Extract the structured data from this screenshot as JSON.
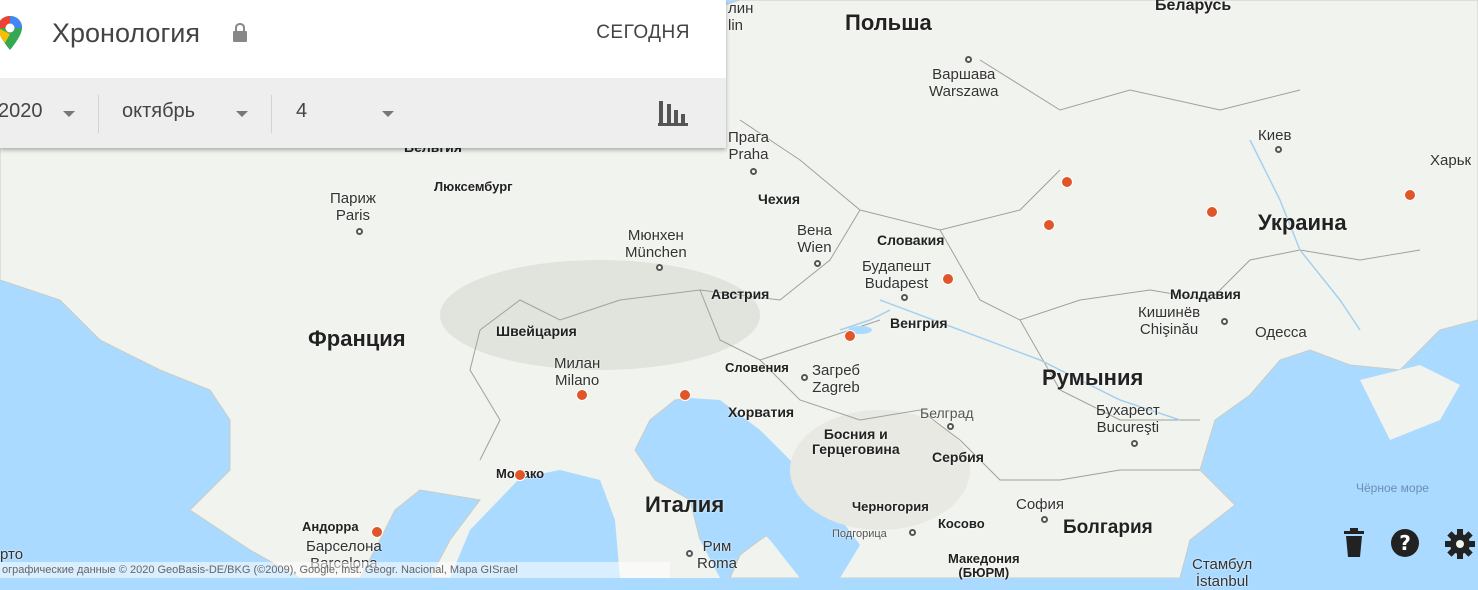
{
  "header": {
    "title": "Хронология",
    "today_label": "СЕГОДНЯ"
  },
  "selectors": {
    "year": "2020",
    "month": "октябрь",
    "day": "4"
  },
  "attribution": "ографические данные © 2020 GeoBasis-DE/BKG (©2009), Google, Inst. Geogr. Nacional, Mapa GISrael",
  "icons": [
    "maps-pin-icon",
    "lock-icon",
    "dropdown-caret-icon",
    "bar-chart-icon",
    "trash-icon",
    "help-icon",
    "settings-icon"
  ],
  "colors": {
    "marker": "#e1552a",
    "land": "#f1f3ee",
    "water": "#aadaff"
  },
  "map": {
    "countries": {
      "poland": "Польша",
      "belarus": "Беларусь",
      "ukraine": "Украина",
      "france": "Франция",
      "romania": "Румыния",
      "italy": "Италия",
      "bulgaria": "Болгария"
    },
    "regions": {
      "belgium": "Бельгия",
      "luxembourg": "Люксембург",
      "czechia": "Чехия",
      "slovakia": "Словакия",
      "austria": "Австрия",
      "hungary": "Венгрия",
      "switzerland": "Швейцария",
      "slovenia": "Словения",
      "croatia": "Хорватия",
      "bosnia": "Босния и\nГерцеговина",
      "serbia": "Сербия",
      "moldova": "Молдавия",
      "montenegro": "Черногория",
      "kosovo": "Косово",
      "macedonia": "Македония\n(БЮРМ)",
      "andorra": "Андорра",
      "monaco": "Монако"
    },
    "cities": {
      "berlin": "лин\nlin",
      "warsaw": "Варшава\nWarszawa",
      "prague": "Прага\nPraha",
      "kyiv": "Киев",
      "kharkiv": "Харьк",
      "paris": "Париж\nParis",
      "munich": "Мюнхен\nMünchen",
      "vienna": "Вена\nWien",
      "budapest": "Будапешт\nBudapest",
      "chisinau": "Кишинёв\nChişinău",
      "odessa": "Одесса",
      "milan": "Милан\nMilano",
      "zagreb": "Загреб\nZagreb",
      "belgrade": "Белград",
      "bucharest": "Бухарест\nBucureşti",
      "sofia": "София",
      "podgorica": "Подгорица",
      "barcelona": "Барселона\nBarcelona",
      "rome": "Рим\nRoma",
      "istanbul": "Стамбул\nİstanbul",
      "porto": "рто"
    },
    "seas": {
      "black_sea": "Чёрное море"
    }
  }
}
